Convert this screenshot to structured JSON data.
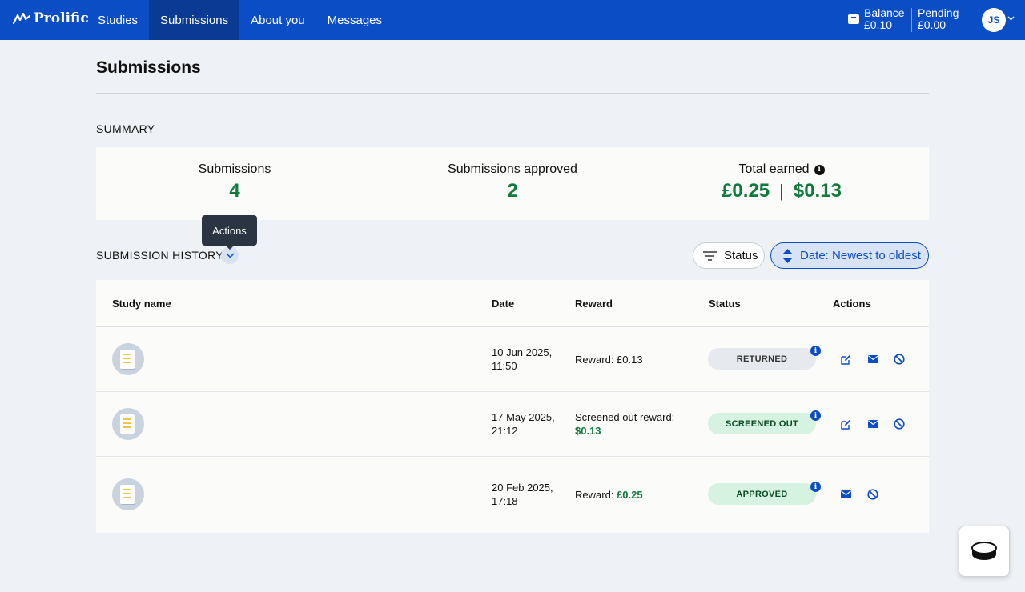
{
  "brand": {
    "name": "Prolific"
  },
  "nav": {
    "items": [
      {
        "label": "Studies"
      },
      {
        "label": "Submissions"
      },
      {
        "label": "About you"
      },
      {
        "label": "Messages"
      }
    ],
    "active": "Submissions"
  },
  "account": {
    "balance_label": "Balance",
    "balance_value": "£0.10",
    "pending_label": "Pending",
    "pending_value": "£0.00",
    "initials": "JS"
  },
  "page": {
    "title": "Submissions"
  },
  "summary": {
    "heading": "SUMMARY",
    "submissions_label": "Submissions",
    "submissions_value": "4",
    "approved_label": "Submissions approved",
    "approved_value": "2",
    "earned_label": "Total earned",
    "earned_gbp": "£0.25",
    "earned_usd": "$0.13"
  },
  "history": {
    "heading": "SUBMISSION HISTORY",
    "tooltip": "Actions",
    "filter_label": "Status",
    "sort_label": "Date: Newest to oldest"
  },
  "table": {
    "headers": {
      "study_name": "Study name",
      "date": "Date",
      "reward": "Reward",
      "status": "Status",
      "actions": "Actions"
    },
    "rows": [
      {
        "date_line1": "10 Jun 2025,",
        "date_line2": "11:50",
        "reward_prefix": "Reward: £0.13",
        "reward_amount": "",
        "status": "RETURNED"
      },
      {
        "date_line1": "17 May 2025,",
        "date_line2": "21:12",
        "reward_prefix": "Screened out reward:",
        "reward_amount": "$0.13",
        "status": "SCREENED OUT"
      },
      {
        "date_line1": "20 Feb 2025,",
        "date_line2": "17:18",
        "reward_prefix": "Reward:",
        "reward_amount": "£0.25",
        "status": "APPROVED"
      }
    ]
  },
  "colors": {
    "nav_blue": "#0b4dc4",
    "green": "#0e7a3c"
  },
  "icons": [
    "wallet-icon",
    "chevron-down-icon",
    "info-icon",
    "filter-icon",
    "sort-icon",
    "edit-icon",
    "mail-icon",
    "block-icon",
    "document-icon",
    "chat-widget-icon"
  ]
}
